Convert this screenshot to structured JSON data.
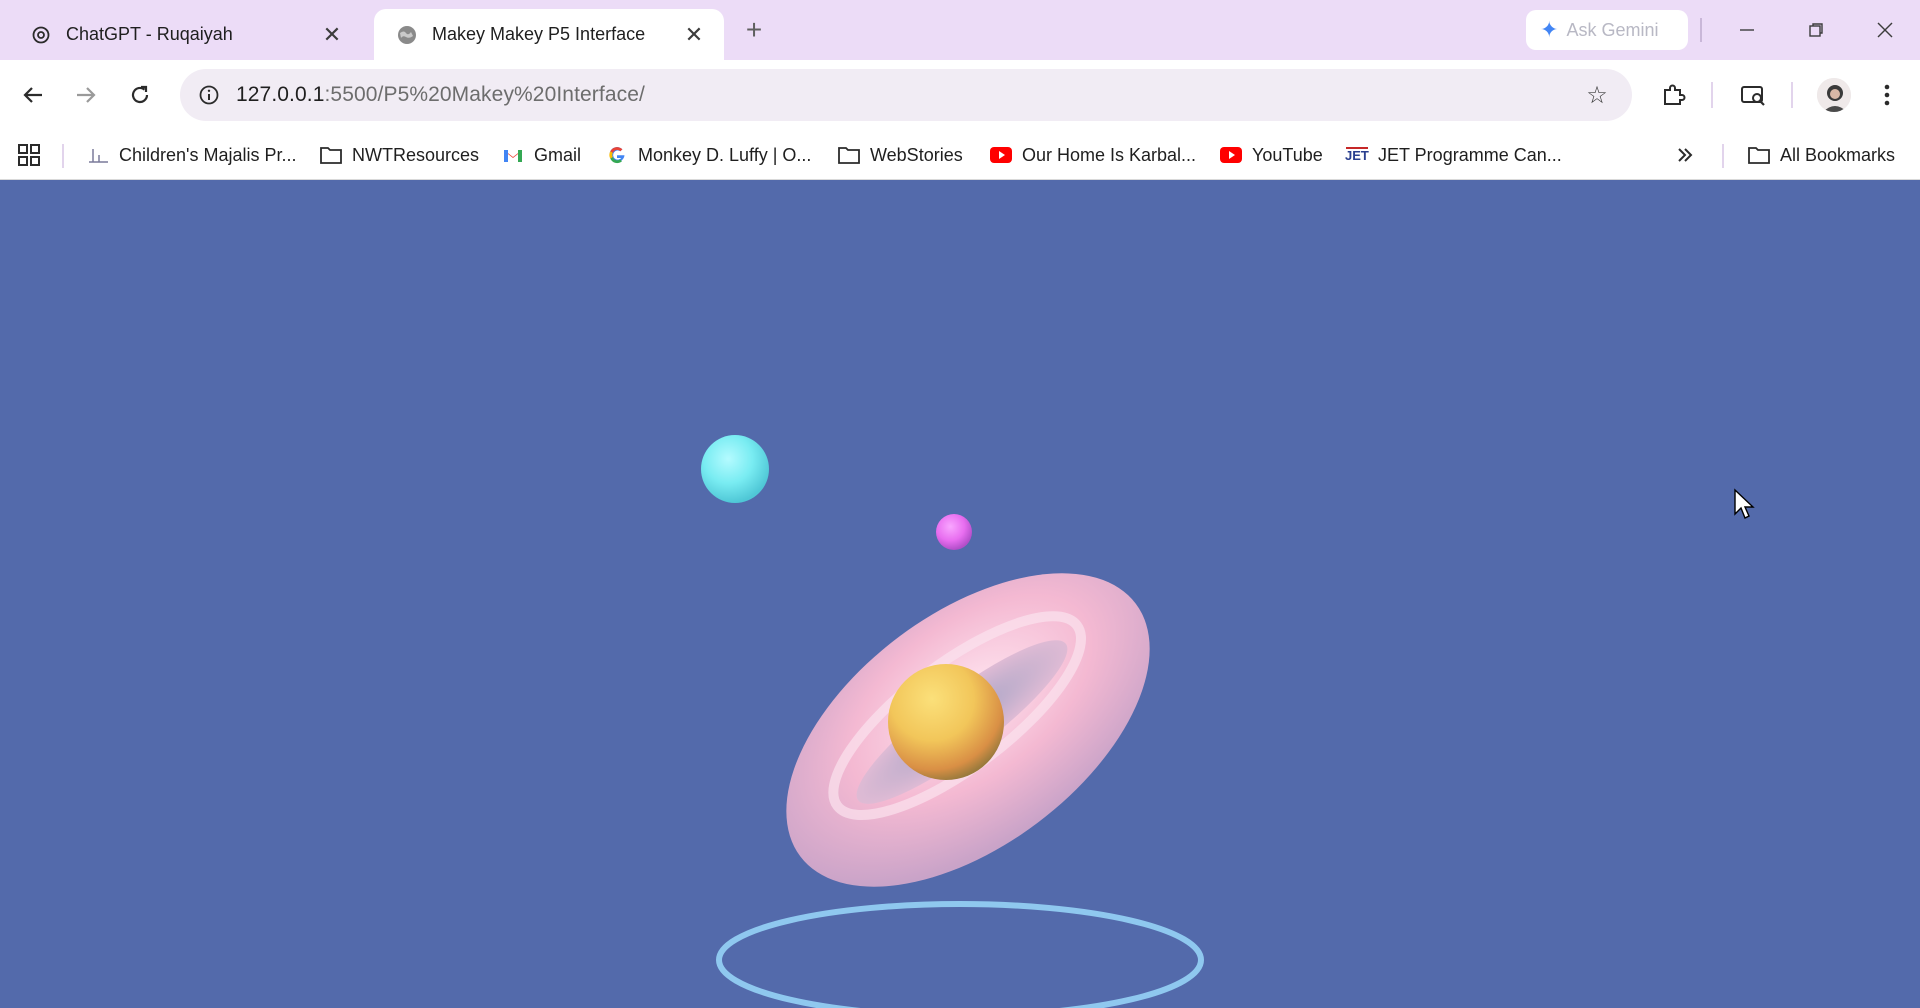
{
  "browser": {
    "tabs": [
      {
        "title": "ChatGPT - Ruqaiyah",
        "active": false,
        "favicon": "openai-icon"
      },
      {
        "title": "Makey Makey P5 Interface",
        "active": true,
        "favicon": "globe-icon"
      }
    ],
    "gemini_label": "Ask Gemini",
    "address": {
      "host": "127.0.0.1",
      "path": ":5500/P5%20Makey%20Interface/"
    }
  },
  "bookmarks": {
    "items": [
      {
        "label": "Children's Majalis Pr...",
        "icon": "chart-favicon"
      },
      {
        "label": "NWTResources",
        "icon": "folder-icon"
      },
      {
        "label": "Gmail",
        "icon": "gmail-icon"
      },
      {
        "label": "Monkey D. Luffy | O...",
        "icon": "google-icon"
      },
      {
        "label": "WebStories",
        "icon": "folder-icon"
      },
      {
        "label": "Our Home Is Karbal...",
        "icon": "youtube-icon"
      },
      {
        "label": "YouTube",
        "icon": "youtube-icon"
      },
      {
        "label": "JET Programme Can...",
        "icon": "jet-icon"
      }
    ],
    "all_bookmarks_label": "All Bookmarks"
  },
  "scene": {
    "background": "#536aab",
    "torus_color": "#f4b9d2",
    "center_sphere_color": "#f2c65a",
    "cyan_sphere_color": "#79ecf2",
    "magenta_sphere_color": "#e86ef0",
    "ring_color": "#8fc8ef"
  }
}
